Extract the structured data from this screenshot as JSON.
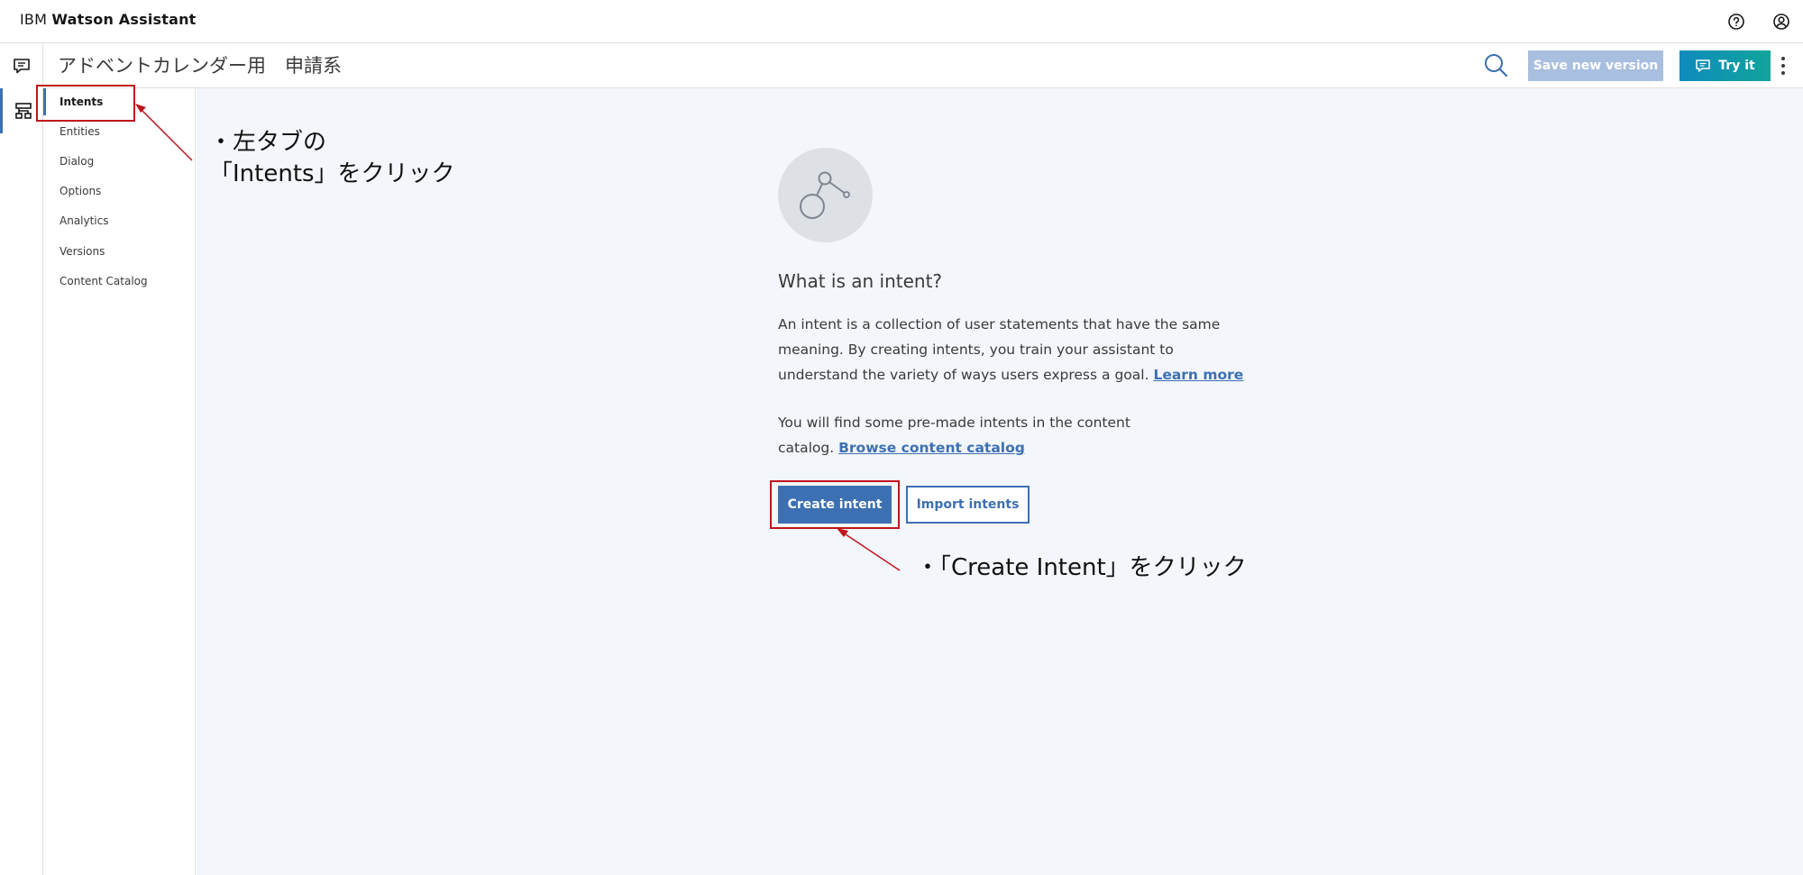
{
  "topbar": {
    "brand_prefix": "IBM",
    "brand_name": "Watson Assistant"
  },
  "subheader": {
    "skill_title": "アドベントカレンダー用　申請系",
    "save_label": "Save new version",
    "tryit_label": "Try it"
  },
  "subnav": {
    "items": [
      {
        "label": "Intents"
      },
      {
        "label": "Entities"
      },
      {
        "label": "Dialog"
      },
      {
        "label": "Options"
      },
      {
        "label": "Analytics"
      },
      {
        "label": "Versions"
      },
      {
        "label": "Content Catalog"
      }
    ]
  },
  "main": {
    "heading": "What is an intent?",
    "para1": "An intent is a collection of user statements that have the same meaning. By creating intents, you train your assistant to understand the variety of ways users express a goal.",
    "learn_more": "Learn more",
    "para2": "You will find some pre-made intents in the content catalog.",
    "browse_link": "Browse content catalog",
    "create_label": "Create intent",
    "import_label": "Import intents"
  },
  "annotations": {
    "left_tab_line1": "・左タブの",
    "left_tab_line2": "「Intents」をクリック",
    "create_intent": "・「Create Intent」をクリック"
  },
  "colors": {
    "accent": "#3d70b2",
    "annotation_red": "#c0141c",
    "save_disabled": "#a9bfe0",
    "main_bg": "#f3f6fb"
  }
}
